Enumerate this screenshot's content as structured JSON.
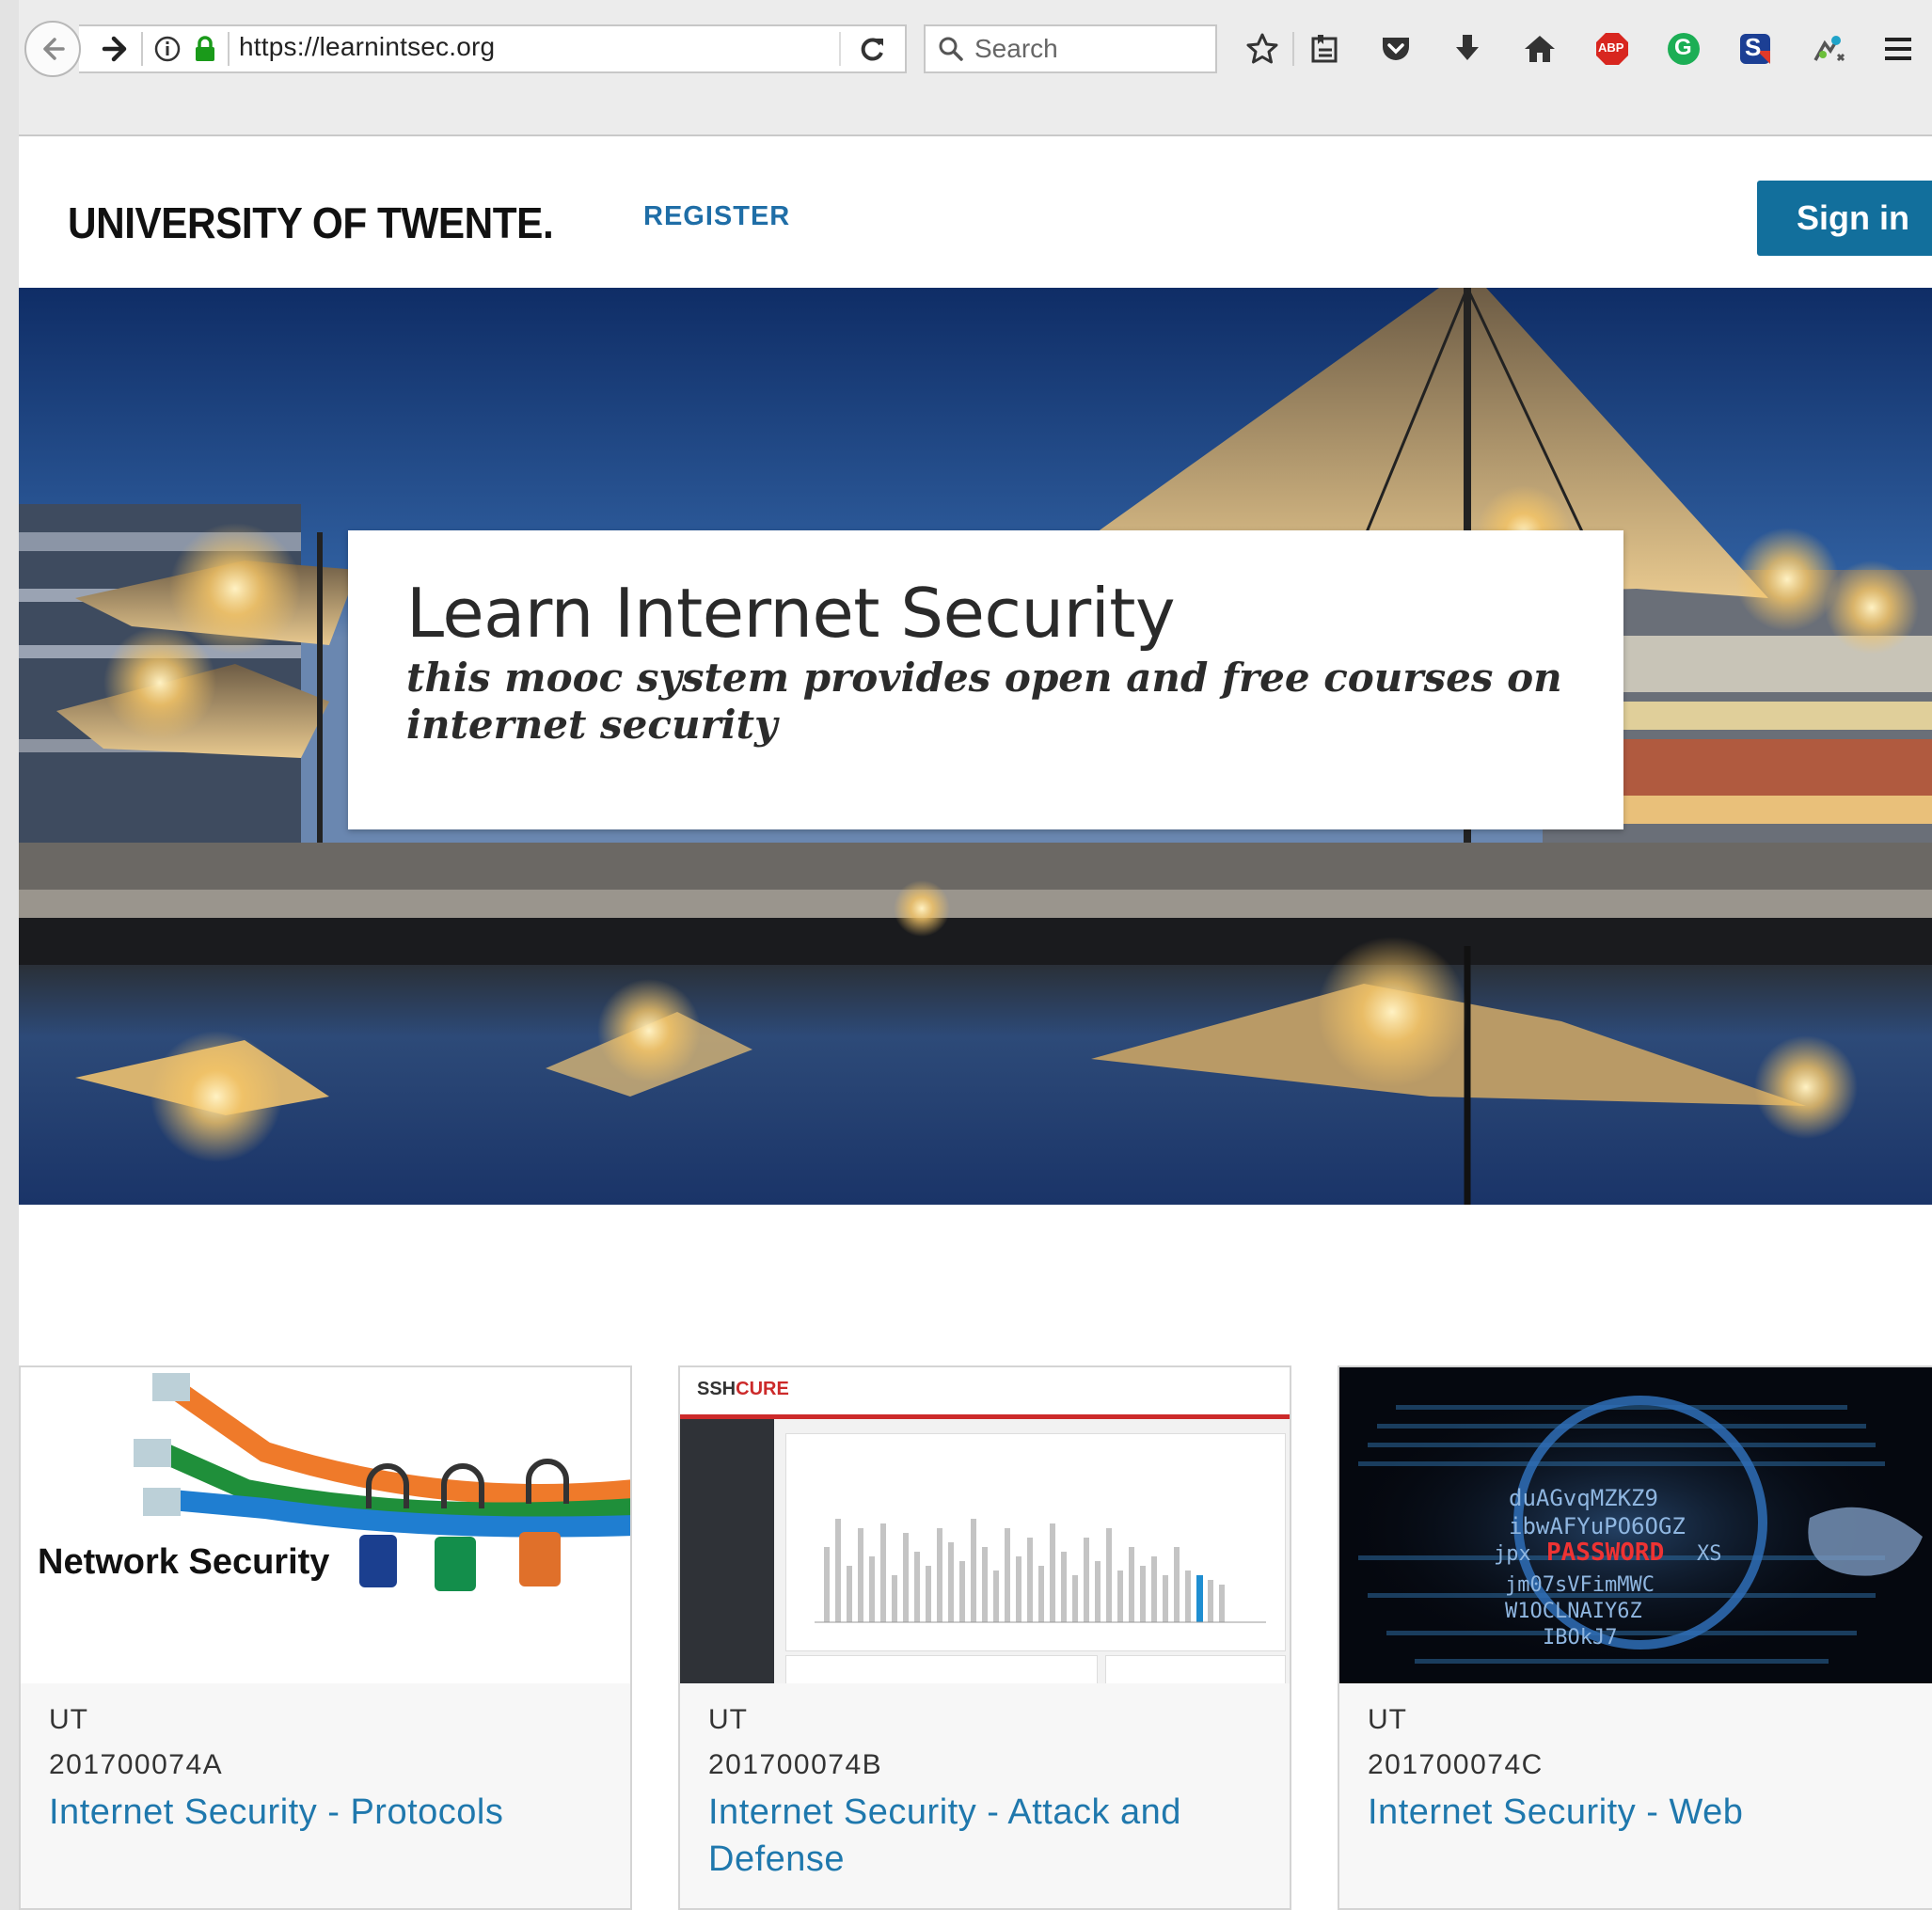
{
  "browser": {
    "url": "https://learnintsec.org",
    "search_placeholder": "Search",
    "toolbar_icons": [
      "back-icon",
      "forward-icon",
      "info-icon",
      "lock-icon",
      "reload-icon",
      "search-icon",
      "star-icon",
      "reading-list-icon",
      "pocket-icon",
      "download-icon",
      "home-icon",
      "adblock-icon",
      "grammarly-icon",
      "extension-s-icon",
      "extension-puzzle-icon",
      "hamburger-menu-icon"
    ],
    "adblock_label": "ABP",
    "grammarly_label": "G",
    "extension_label": "S"
  },
  "header": {
    "logo": "UNIVERSITY OF TWENTE.",
    "register_label": "REGISTER",
    "signin_label": "Sign in"
  },
  "hero": {
    "title": "Learn Internet Security",
    "subtitle": "this mooc system provides open and free courses on internet security"
  },
  "courses": [
    {
      "image_caption": "Network Security",
      "org": "UT",
      "code": "201700074A",
      "title": "Internet Security - Protocols"
    },
    {
      "image_brand_a": "SSH",
      "image_brand_b": "CURE",
      "org": "UT",
      "code": "201700074B",
      "title": "Internet Security - Attack and Defense"
    },
    {
      "image_word": "PASSWORD",
      "image_lines": [
        "duAGvqMZKZ9",
        "ibwAFYuPO6OGZ",
        "jpx",
        "XS",
        "jm07sVFimMWC",
        "W1OCLNAIY6Z",
        "IBOkJ7"
      ],
      "org": "UT",
      "code": "201700074C",
      "title": "Internet Security - Web"
    }
  ],
  "colors": {
    "accent": "#1f78ad",
    "signin_bg": "#126f9c",
    "sshcure_red": "#cc2a2a"
  }
}
